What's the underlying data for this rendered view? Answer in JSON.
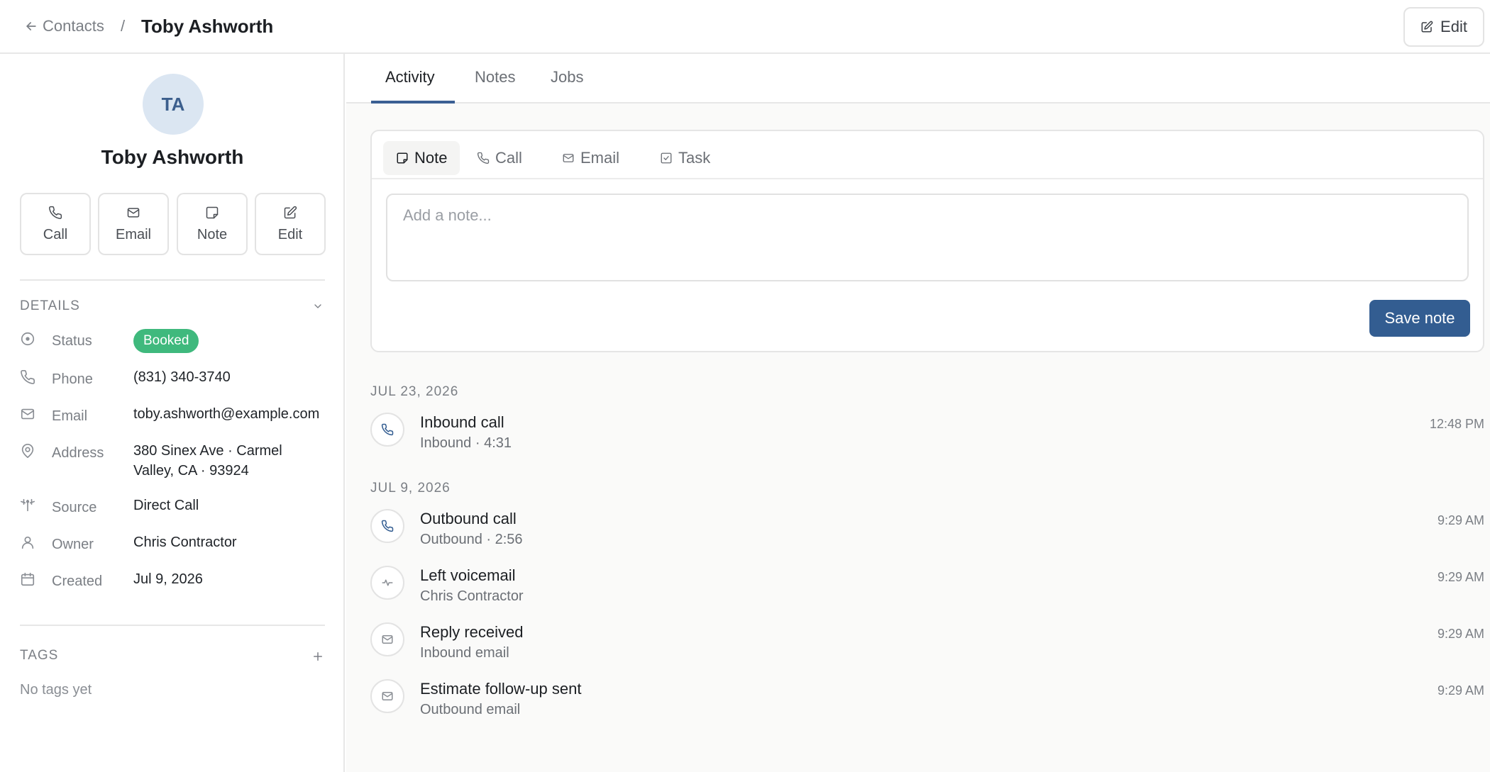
{
  "header": {
    "back_label": "Contacts",
    "separator": "/",
    "title": "Toby Ashworth",
    "edit_label": "Edit"
  },
  "contact": {
    "initials": "TA",
    "name": "Toby Ashworth"
  },
  "quick_actions": [
    {
      "label": "Call",
      "icon": "phone-icon"
    },
    {
      "label": "Email",
      "icon": "mail-icon"
    },
    {
      "label": "Note",
      "icon": "note-icon"
    },
    {
      "label": "Edit",
      "icon": "edit-icon"
    }
  ],
  "details": {
    "title": "DETAILS",
    "status": {
      "label": "Status",
      "value": "Booked",
      "color": "#3fb97d"
    },
    "phone": {
      "label": "Phone",
      "value": "(831) 340-3740"
    },
    "email": {
      "label": "Email",
      "value": "toby.ashworth@example.com"
    },
    "address": {
      "label": "Address",
      "line1": "380 Sinex Ave · Carmel",
      "line2": "Valley, CA · 93924"
    },
    "source": {
      "label": "Source",
      "value": "Direct Call"
    },
    "owner": {
      "label": "Owner",
      "value": "Chris Contractor"
    },
    "created": {
      "label": "Created",
      "value": "Jul 9, 2026"
    }
  },
  "tags": {
    "title": "TAGS",
    "empty": "No tags yet"
  },
  "tabs": [
    {
      "label": "Activity",
      "active": true
    },
    {
      "label": "Notes",
      "active": false
    },
    {
      "label": "Jobs",
      "active": false
    }
  ],
  "composer": {
    "tabs": [
      {
        "label": "Note",
        "icon": "note-icon",
        "active": true
      },
      {
        "label": "Call",
        "icon": "phone-icon",
        "active": false
      },
      {
        "label": "Email",
        "icon": "mail-icon",
        "active": false
      },
      {
        "label": "Task",
        "icon": "checkbox-icon",
        "active": false
      }
    ],
    "placeholder": "Add a note...",
    "save_label": "Save note"
  },
  "activity_groups": [
    {
      "date": "JUL 23, 2026",
      "items": [
        {
          "title": "Inbound call",
          "subtitle": "Inbound · 4:31",
          "time": "12:48 PM",
          "icon": "phone-icon"
        }
      ]
    },
    {
      "date": "JUL 9, 2026",
      "items": [
        {
          "title": "Outbound call",
          "subtitle": "Outbound · 2:56",
          "time": "9:29 AM",
          "icon": "phone-icon"
        },
        {
          "title": "Left voicemail",
          "subtitle": "Chris Contractor",
          "time": "9:29 AM",
          "icon": "voicemail-icon"
        },
        {
          "title": "Reply received",
          "subtitle": "Inbound email",
          "time": "9:29 AM",
          "icon": "mail-icon"
        },
        {
          "title": "Estimate follow-up sent",
          "subtitle": "Outbound email",
          "time": "9:29 AM",
          "icon": "mail-icon"
        }
      ]
    }
  ]
}
